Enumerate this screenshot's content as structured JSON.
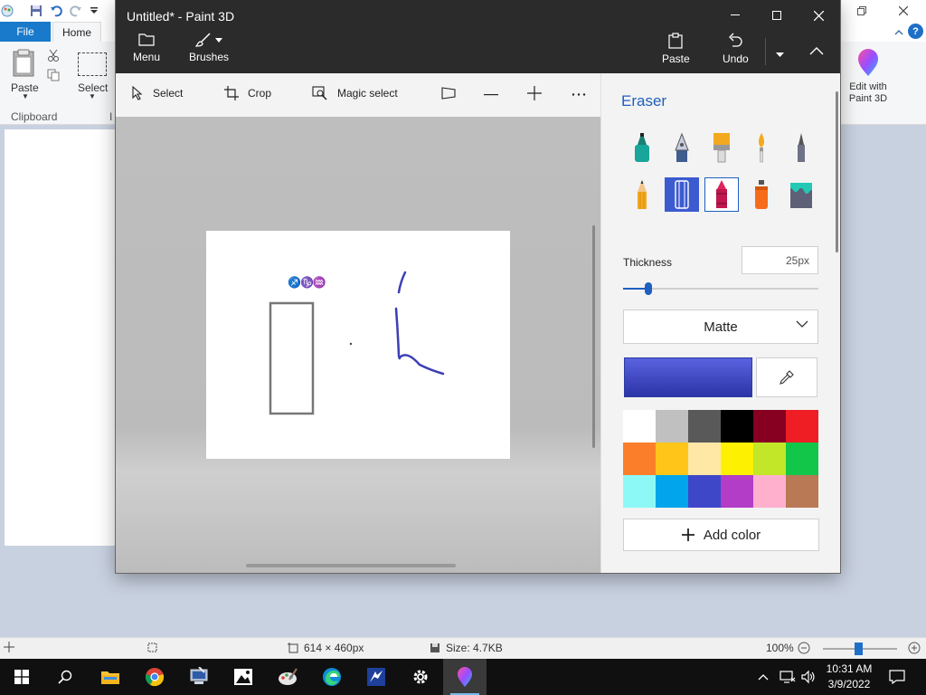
{
  "paint": {
    "tabs": {
      "file": "File",
      "home": "Home"
    },
    "ribbon": {
      "paste_label": "Paste",
      "select_label": "Select",
      "clipboard_group": "Clipboard",
      "edit3d_label_line1": "Edit with",
      "edit3d_label_line2": "Paint 3D"
    },
    "status": {
      "dimensions": "614 × 460px",
      "size": "Size: 4.7KB",
      "zoom": "100%",
      "zoom_fraction": 0.47
    }
  },
  "p3d": {
    "title": "Untitled* - Paint 3D",
    "commands": {
      "menu": "Menu",
      "brushes": "Brushes",
      "paste": "Paste",
      "undo": "Undo"
    },
    "tools": {
      "select": "Select",
      "crop": "Crop",
      "magic_select": "Magic select"
    },
    "canvas": {
      "annotation": "♐♑♒"
    },
    "panel": {
      "title": "Eraser",
      "thickness_label": "Thickness",
      "thickness_value": "25px",
      "thickness_fraction": 0.13,
      "finish": "Matte",
      "add_color": "Add color",
      "current_color_top": "#5b62e0",
      "current_color_bottom": "#2b34a8",
      "palette": [
        "#ffffff",
        "#c0c0c0",
        "#595959",
        "#000000",
        "#870022",
        "#ee1e24",
        "#fb7f2a",
        "#ffc619",
        "#ffe8a6",
        "#fef001",
        "#c1e728",
        "#12c64a",
        "#8df9f6",
        "#00a5ec",
        "#3e47c8",
        "#b33dc6",
        "#ffb0cd",
        "#b97955"
      ]
    }
  },
  "taskbar": {
    "time": "10:31 AM",
    "date": "3/9/2022"
  }
}
